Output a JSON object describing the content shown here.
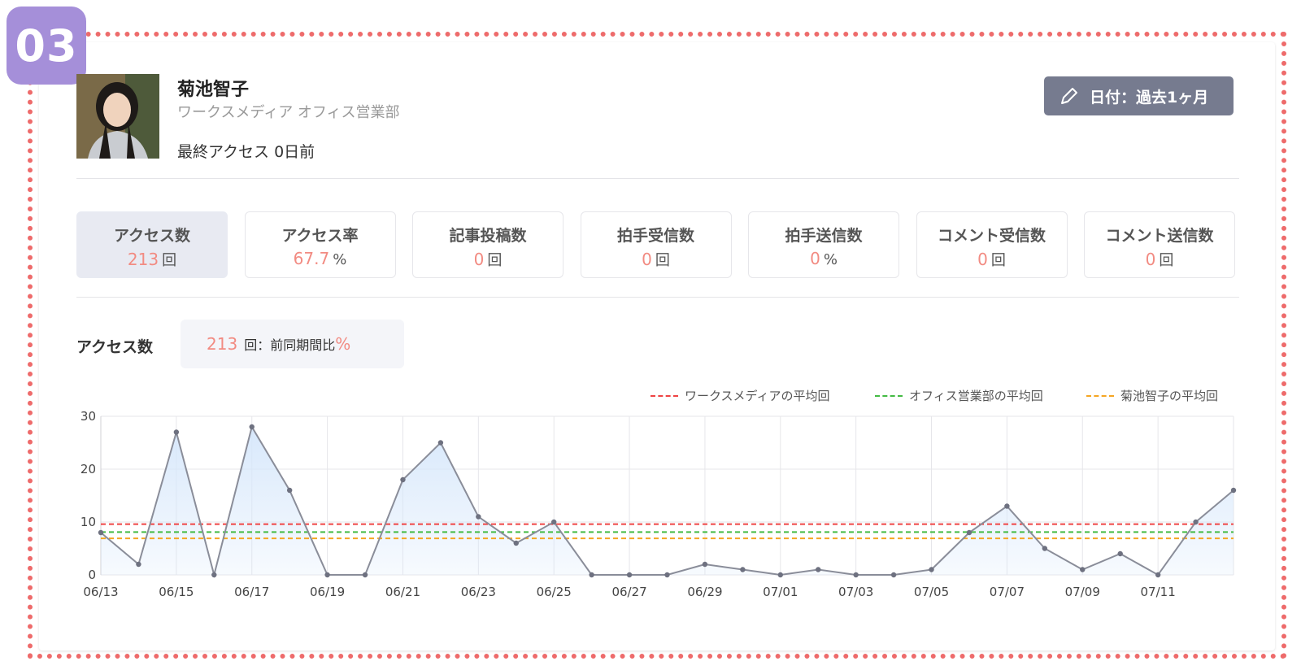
{
  "badge": "03",
  "user": {
    "name": "菊池智子",
    "department": "ワークスメディア オフィス営業部",
    "last_access": "最終アクセス 0日前"
  },
  "date_filter": {
    "label": "日付：過去1ヶ月",
    "icon": "pencil-icon"
  },
  "stats": [
    {
      "label": "アクセス数",
      "value": "213",
      "unit": "回",
      "active": true
    },
    {
      "label": "アクセス率",
      "value": "67.7",
      "unit": "%"
    },
    {
      "label": "記事投稿数",
      "value": "0",
      "unit": "回"
    },
    {
      "label": "拍手受信数",
      "value": "0",
      "unit": "回"
    },
    {
      "label": "拍手送信数",
      "value": "0",
      "unit": "%"
    },
    {
      "label": "コメント受信数",
      "value": "0",
      "unit": "回"
    },
    {
      "label": "コメント送信数",
      "value": "0",
      "unit": "回"
    }
  ],
  "section": {
    "title": "アクセス数",
    "summary_value": "213",
    "summary_text": "回：前同期間比",
    "summary_pct": "%"
  },
  "colors": {
    "accent": "#f28b82",
    "line": "#8a8d99",
    "area": "#d6e7fb",
    "avg_company": "#ef4444",
    "avg_dept": "#44bb44",
    "avg_user": "#f5a623",
    "button": "#767b8f",
    "badge": "#a58fd9",
    "frame": "#ee6b6b"
  },
  "chart_data": {
    "type": "area",
    "x": [
      "06/13",
      "06/14",
      "06/15",
      "06/16",
      "06/17",
      "06/18",
      "06/19",
      "06/20",
      "06/21",
      "06/22",
      "06/23",
      "06/24",
      "06/25",
      "06/26",
      "06/27",
      "06/28",
      "06/29",
      "06/30",
      "07/01",
      "07/02",
      "07/03",
      "07/04",
      "07/05",
      "07/06",
      "07/07",
      "07/08",
      "07/09",
      "07/10",
      "07/11",
      "07/12",
      "07/13"
    ],
    "x_tick_labels": [
      "06/13",
      "06/15",
      "06/17",
      "06/19",
      "06/21",
      "06/23",
      "06/25",
      "06/27",
      "06/29",
      "07/01",
      "07/03",
      "07/05",
      "07/07",
      "07/09",
      "07/11"
    ],
    "series": [
      {
        "values": [
          8,
          2,
          27,
          0,
          28,
          16,
          0,
          0,
          18,
          25,
          11,
          6,
          10,
          0,
          0,
          0,
          2,
          1,
          0,
          1,
          0,
          0,
          1,
          8,
          13,
          5,
          1,
          4,
          0,
          10,
          16
        ]
      }
    ],
    "reference_lines": [
      {
        "name": "ワークスメディアの平均回",
        "value": 9.6,
        "color": "#ef4444"
      },
      {
        "name": "オフィス営業部の平均回",
        "value": 8.1,
        "color": "#44bb44"
      },
      {
        "name": "菊池智子の平均回",
        "value": 6.9,
        "color": "#f5a623"
      }
    ],
    "yticks": [
      0,
      10,
      20,
      30
    ],
    "ylim": [
      0,
      30
    ],
    "grid": true,
    "legend_position": "top-right"
  }
}
